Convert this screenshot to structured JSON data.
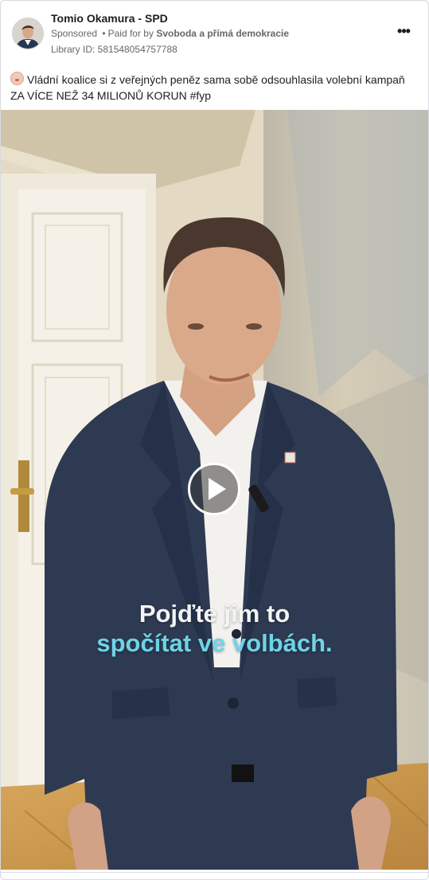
{
  "post": {
    "page_name": "Tomio Okamura - SPD",
    "sponsored": "Sponsored",
    "dot": "•",
    "paid_for_prefix": "Paid for by",
    "payer": "Svoboda a přímá demokracie",
    "library_id": "Library ID: 581548054757788",
    "more_label": "•••",
    "emoji_icon": "face-emoji-icon",
    "caption_line1": "Vládní koalice si z veřejných peněz sama sobě odsouhlasila volební kampaň",
    "caption_line2": "ZA VÍCE NEŽ 34 MILIONŮ KORUN #fyp"
  },
  "video": {
    "subtitle_line1": "Pojďte jim to",
    "subtitle_line2": "spočítat ve volbách.",
    "play_icon": "play-icon",
    "subtitle_colors": {
      "line1": "#f4f4f4",
      "line2": "#6fd3e6"
    }
  }
}
